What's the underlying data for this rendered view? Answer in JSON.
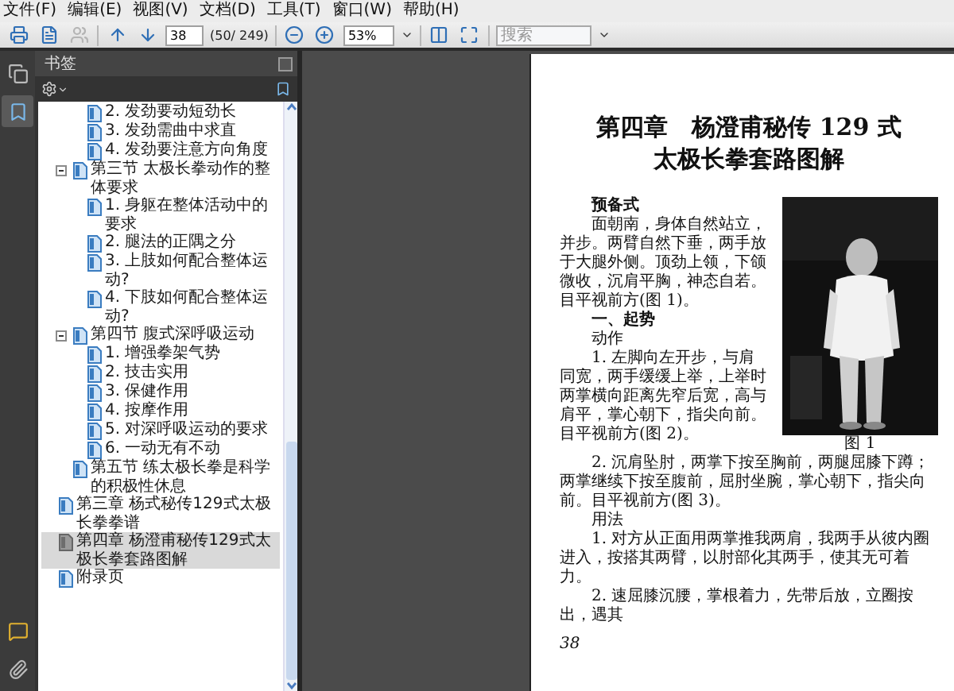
{
  "menu": [
    "文件(F)",
    "编辑(E)",
    "视图(V)",
    "文档(D)",
    "工具(T)",
    "窗口(W)",
    "帮助(H)"
  ],
  "toolbar": [
    {
      "kind": "print",
      "disabled": false
    },
    {
      "kind": "create",
      "disabled": false
    },
    {
      "kind": "collaborate",
      "disabled": true
    },
    {
      "kind": "separator"
    },
    {
      "kind": "prev",
      "disabled": false
    },
    {
      "kind": "next",
      "disabled": false
    },
    {
      "kind": "page_input",
      "value": "38"
    },
    {
      "kind": "page_count",
      "text": "(50/ 249)"
    },
    {
      "kind": "separator"
    },
    {
      "kind": "zoom_out",
      "disabled": false
    },
    {
      "kind": "zoom_in",
      "disabled": false
    },
    {
      "kind": "zoom_input",
      "value": "53%"
    },
    {
      "kind": "separator"
    },
    {
      "kind": "fit_page",
      "disabled": false
    },
    {
      "kind": "full_screen",
      "disabled": false
    },
    {
      "kind": "separator"
    },
    {
      "kind": "search",
      "placeholder": "搜索"
    }
  ],
  "side_tabs": [
    {
      "kind": "pages",
      "selected": false
    },
    {
      "kind": "bookmarks",
      "selected": true
    }
  ],
  "side_tools": [
    {
      "kind": "comments"
    },
    {
      "kind": "attachments"
    }
  ],
  "bookmark_panel": {
    "title": "书签"
  },
  "bookmarks": [
    {
      "children": [
        {
          "children": [
            {
              "label": "2. 发劲要动短劲长",
              "selected": false
            },
            {
              "label": "3. 发劲需曲中求直",
              "selected": false
            },
            {
              "label": "4. 发劲要注意方向角度",
              "selected": false
            }
          ]
        },
        {
          "label": "第三节 太极长拳动作的整体要求",
          "selected": false,
          "expanded": true,
          "children": [
            {
              "label": "1. 身躯在整体活动中的要求",
              "selected": false
            },
            {
              "label": "2. 腿法的正隅之分",
              "selected": false
            },
            {
              "label": "3. 上肢如何配合整体运动?",
              "selected": false
            },
            {
              "label": "4. 下肢如何配合整体运动?",
              "selected": false
            }
          ]
        },
        {
          "label": "第四节 腹式深呼吸运动",
          "selected": false,
          "expanded": true,
          "children": [
            {
              "label": "1. 增强拳架气势",
              "selected": false
            },
            {
              "label": "2. 技击实用",
              "selected": false
            },
            {
              "label": "3. 保健作用",
              "selected": false
            },
            {
              "label": "4. 按摩作用",
              "selected": false
            },
            {
              "label": "5. 对深呼吸运动的要求",
              "selected": false
            },
            {
              "label": "6. 一动无有不动",
              "selected": false
            }
          ]
        },
        {
          "label": "第五节 练太极长拳是科学的积极性休息",
          "selected": false
        }
      ]
    },
    {
      "label": "第三章 杨式秘传129式太极长拳拳谱",
      "selected": false
    },
    {
      "label": "第四章 杨澄甫秘传129式太极长拳套路图解",
      "selected": true
    },
    {
      "label": "附录页",
      "selected": false
    }
  ],
  "page": {
    "title": [
      "第四章　杨澄甫秘传 129 式",
      "太极长拳套路图解"
    ],
    "intro": [
      {
        "kind": "heading",
        "text": "预备式"
      },
      {
        "kind": "paragraph",
        "text": "面朝南，身体自然站立，并步。两臂自然下垂，两手放于大腿外侧。顶劲上领，下颌微收，沉肩平胸，神态自若。目平视前方(图 1)。"
      },
      {
        "kind": "heading",
        "text": "一、起势"
      },
      {
        "kind": "label",
        "text": "动作"
      },
      {
        "kind": "paragraph",
        "text": "1. 左脚向左开步，与肩同宽，两手缓缓上举，上举时两掌横向距离先窄后宽，高与肩平，掌心朝下，指尖向前。目平视前方(图 2)。"
      }
    ],
    "figure": {
      "caption": "图 1"
    },
    "blocks": [
      {
        "kind": "paragraph",
        "text": "2. 沉肩坠肘，两掌下按至胸前，两腿屈膝下蹲；两掌继续下按至腹前，屈肘坐腕，掌心朝下，指尖向前。目平视前方(图 3)。"
      },
      {
        "kind": "label",
        "text": "用法"
      },
      {
        "kind": "paragraph",
        "text": "1. 对方从正面用两掌推我两肩，我两手从彼内圈进入，按搭其两臂，以肘部化其两手，使其无可着力。"
      },
      {
        "kind": "paragraph",
        "text": "2. 速屈膝沉腰，掌根着力，先带后放，立圈按出，遇其"
      }
    ],
    "page_number": "38"
  }
}
